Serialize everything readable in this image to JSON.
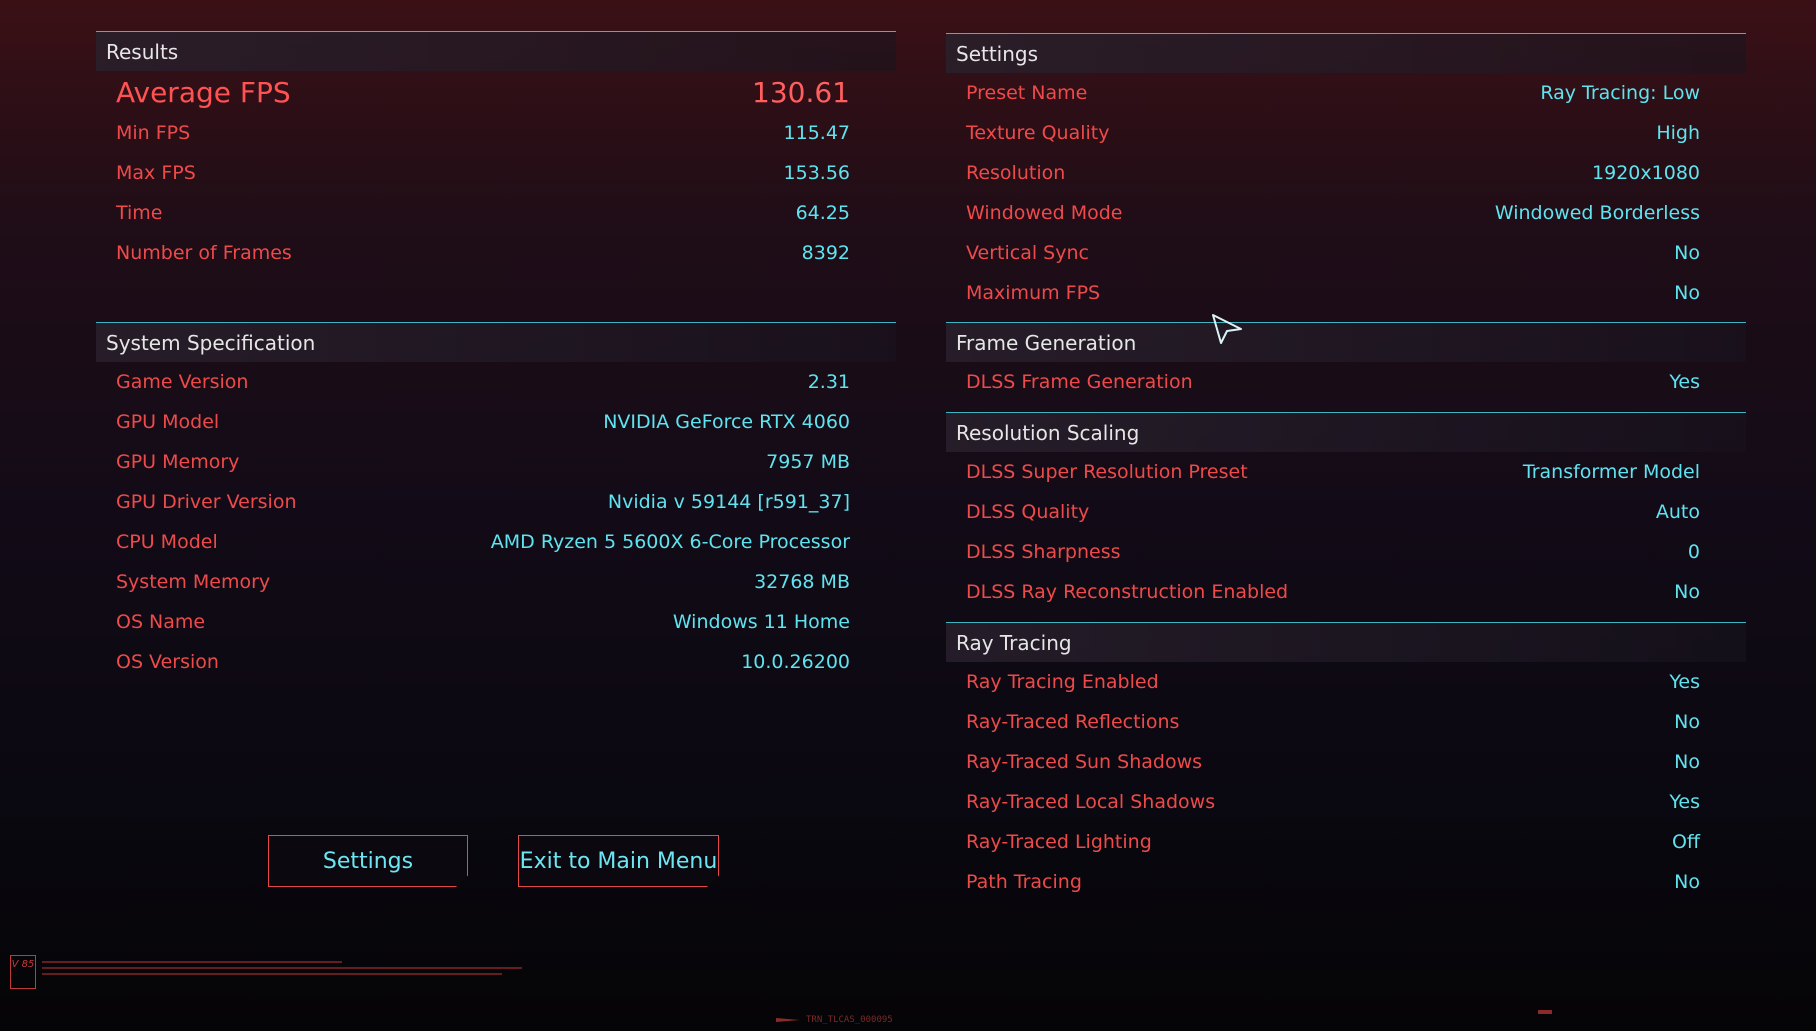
{
  "results": {
    "title": "Results",
    "average": {
      "label": "Average FPS",
      "value": "130.61"
    },
    "rows": [
      {
        "label": "Min FPS",
        "value": "115.47"
      },
      {
        "label": "Max FPS",
        "value": "153.56"
      },
      {
        "label": "Time",
        "value": "64.25"
      },
      {
        "label": "Number of Frames",
        "value": "8392"
      }
    ]
  },
  "system": {
    "title": "System Specification",
    "rows": [
      {
        "label": "Game Version",
        "value": "2.31"
      },
      {
        "label": "GPU Model",
        "value": "NVIDIA GeForce RTX 4060"
      },
      {
        "label": "GPU Memory",
        "value": "7957 MB"
      },
      {
        "label": "GPU Driver Version",
        "value": "Nvidia v 59144 [r591_37]"
      },
      {
        "label": "CPU Model",
        "value": "AMD Ryzen 5 5600X 6-Core Processor"
      },
      {
        "label": "System Memory",
        "value": "32768 MB"
      },
      {
        "label": "OS Name",
        "value": "Windows 11 Home"
      },
      {
        "label": "OS Version",
        "value": "10.0.26200"
      }
    ]
  },
  "settings": {
    "title": "Settings",
    "rows": [
      {
        "label": "Preset Name",
        "value": "Ray Tracing: Low"
      },
      {
        "label": "Texture Quality",
        "value": "High"
      },
      {
        "label": "Resolution",
        "value": "1920x1080"
      },
      {
        "label": "Windowed Mode",
        "value": "Windowed Borderless"
      },
      {
        "label": "Vertical Sync",
        "value": "No"
      },
      {
        "label": "Maximum FPS",
        "value": "No"
      }
    ]
  },
  "frame_generation": {
    "title": "Frame Generation",
    "rows": [
      {
        "label": "DLSS Frame Generation",
        "value": "Yes"
      }
    ]
  },
  "resolution_scaling": {
    "title": "Resolution Scaling",
    "rows": [
      {
        "label": "DLSS Super Resolution Preset",
        "value": "Transformer Model"
      },
      {
        "label": "DLSS Quality",
        "value": "Auto"
      },
      {
        "label": "DLSS Sharpness",
        "value": "0"
      },
      {
        "label": "DLSS Ray Reconstruction Enabled",
        "value": "No"
      }
    ]
  },
  "ray_tracing": {
    "title": "Ray Tracing",
    "rows": [
      {
        "label": "Ray Tracing Enabled",
        "value": "Yes"
      },
      {
        "label": "Ray-Traced Reflections",
        "value": "No"
      },
      {
        "label": "Ray-Traced Sun Shadows",
        "value": "No"
      },
      {
        "label": "Ray-Traced Local Shadows",
        "value": "Yes"
      },
      {
        "label": "Ray-Traced Lighting",
        "value": "Off"
      },
      {
        "label": "Path Tracing",
        "value": "No"
      }
    ]
  },
  "buttons": {
    "settings": "Settings",
    "exit": "Exit to Main Menu"
  },
  "footer": {
    "version_badge": "V 85",
    "tag": "TRN_TLCAS_000095"
  },
  "icons": {
    "cursor": "mouse-pointer-icon",
    "badge": "version-badge-icon"
  },
  "colors": {
    "label": "#ee4a4a",
    "value": "#5fe3ef",
    "accent_line": "#3fb5c2",
    "button_border": "#e44848"
  }
}
